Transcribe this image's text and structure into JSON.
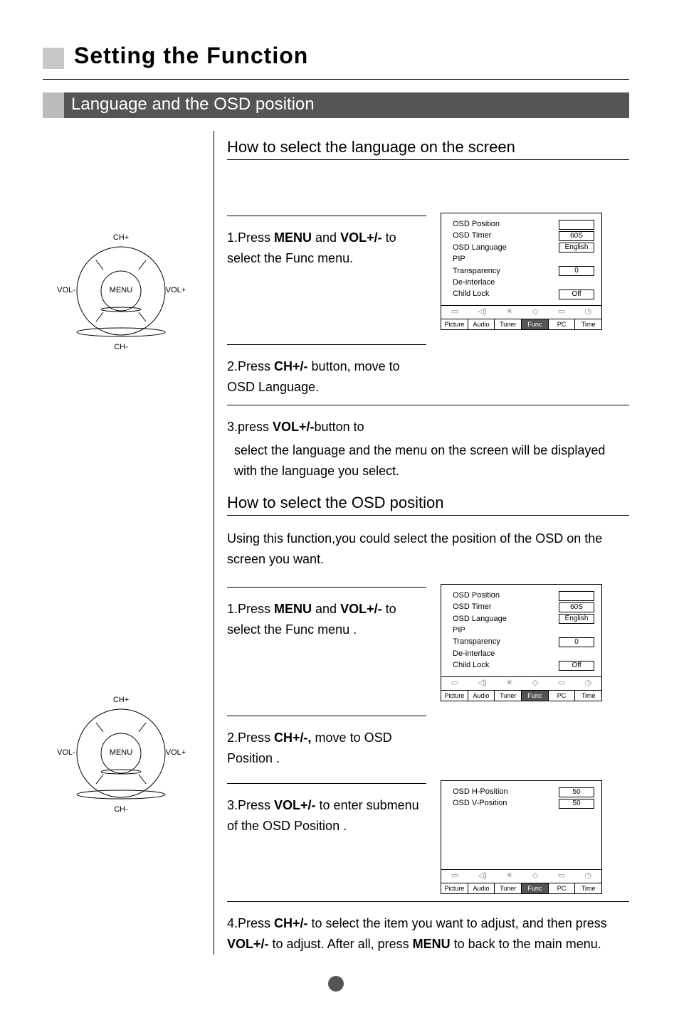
{
  "page": {
    "title": "Setting the Function",
    "section": "Language and the OSD position",
    "subhead1": "How to select the language on the screen",
    "subhead2": "How to select the OSD position",
    "body2_intro": "Using this function,you could select the position of the OSD on the screen you want."
  },
  "dial": {
    "up": "CH+",
    "down": "CH-",
    "left": "VOL-",
    "right": "VOL+",
    "center": "MENU"
  },
  "steps_lang": {
    "s1_a": "1.Press ",
    "s1_b": "MENU",
    "s1_c": " and ",
    "s1_d": "VOL+/-",
    "s1_e": " to select the Func menu.",
    "s2_a": " 2.Press ",
    "s2_b": "CH+/-",
    "s2_c": " button, move  to OSD Language.",
    "s3_a": "3.press ",
    "s3_b": "VOL+/-",
    "s3_c": "button to",
    "s3_rest": "select the language and the menu on the screen will be displayed with the language you select."
  },
  "steps_pos": {
    "s1_a": "1.Press ",
    "s1_b": "MENU",
    "s1_c": " and ",
    "s1_d": "VOL+/-",
    "s1_e": " to select the Func menu .",
    "s2_a": "2.Press ",
    "s2_b": "CH+/-,",
    "s2_c": " move to OSD Position .",
    "s3_a": "3.Press ",
    "s3_b": "VOL+/-",
    "s3_c": " to enter submenu of the OSD Position .",
    "s4_a": "4.Press ",
    "s4_b": "CH+/-",
    "s4_c": " to select the item you want to adjust, and then press ",
    "s4_d": "VOL+/-",
    "s4_e": " to adjust. After all, press ",
    "s4_f": "MENU",
    "s4_g": " to back to the main menu."
  },
  "osd_menu": {
    "rows": [
      {
        "label": "OSD Position",
        "value": ""
      },
      {
        "label": "OSD Timer",
        "value": "60S"
      },
      {
        "label": "OSD Language",
        "value": "English"
      },
      {
        "label": "PIP",
        "value": null
      },
      {
        "label": "Transparency",
        "value": "0"
      },
      {
        "label": "De-interlace",
        "value": null
      },
      {
        "label": "Child Lock",
        "value": "Off"
      }
    ],
    "tabs": [
      "Picture",
      "Audio",
      "Tuner",
      "Func",
      "PC",
      "Time"
    ],
    "active_tab": "Func"
  },
  "osd_submenu": {
    "rows": [
      {
        "label": "OSD H-Position",
        "value": "50"
      },
      {
        "label": "OSD V-Position",
        "value": "50"
      }
    ],
    "tabs": [
      "Picture",
      "Audio",
      "Tuner",
      "Func",
      "PC",
      "Time"
    ],
    "active_tab": "Func"
  }
}
